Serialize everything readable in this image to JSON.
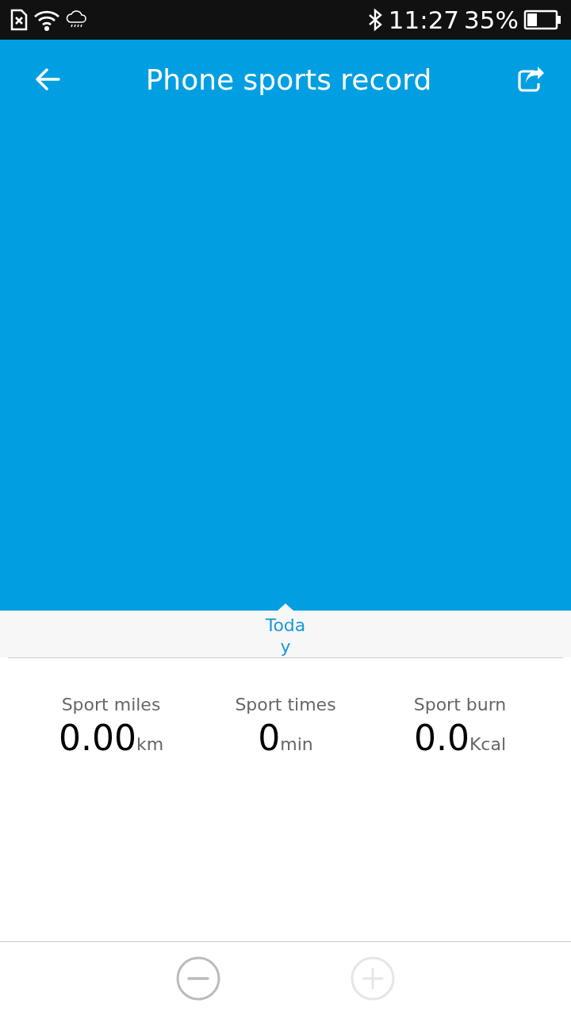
{
  "status_bar": {
    "time": "11:27",
    "battery_percent": "35%"
  },
  "header": {
    "title": "Phone sports record"
  },
  "period_tab": {
    "label": "Today",
    "selected": true
  },
  "stats": [
    {
      "label": "Sport miles",
      "value": "0.00",
      "unit": "km"
    },
    {
      "label": "Sport times",
      "value": "0",
      "unit": "min"
    },
    {
      "label": "Sport burn",
      "value": "0.0",
      "unit": "Kcal"
    }
  ],
  "controls": [
    {
      "kind": "minus",
      "disabled": false
    },
    {
      "kind": "plus",
      "disabled": true
    }
  ]
}
